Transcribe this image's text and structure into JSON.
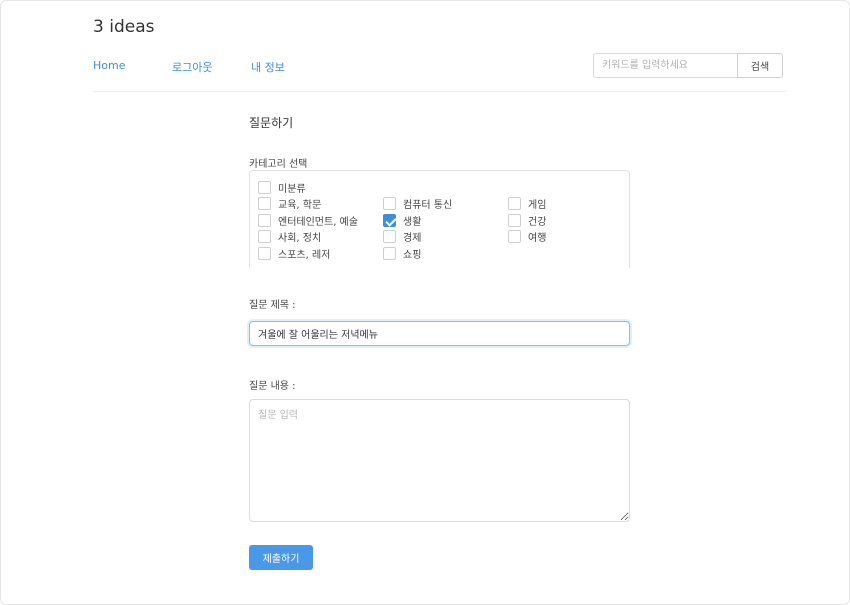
{
  "brand": "3 ideas",
  "nav": {
    "home": "Home",
    "logout": "로그아웃",
    "my_info": "내 정보"
  },
  "search": {
    "placeholder": "키워드를 입력하세요",
    "button": "검색"
  },
  "form": {
    "title": "질문하기",
    "category_label": "카테고리 선택",
    "categories": [
      {
        "label": "미분류",
        "checked": false
      },
      {
        "label": "교육, 학문",
        "checked": false
      },
      {
        "label": "엔터테인먼트, 예술",
        "checked": false
      },
      {
        "label": "사회, 정치",
        "checked": false
      },
      {
        "label": "스포츠, 레저",
        "checked": false
      },
      {
        "label": "컴퓨터 통신",
        "checked": false
      },
      {
        "label": "생활",
        "checked": true
      },
      {
        "label": "경제",
        "checked": false
      },
      {
        "label": "쇼핑",
        "checked": false
      },
      {
        "label": "게임",
        "checked": false
      },
      {
        "label": "건강",
        "checked": false
      },
      {
        "label": "여행",
        "checked": false
      }
    ],
    "question_title_label": "질문 제목 :",
    "question_title_value": "겨울에 잘 어울리는 저녁메뉴",
    "question_content_label": "질문 내용 :",
    "question_content_placeholder": "질문 입력",
    "submit": "제출하기"
  },
  "colors": {
    "accent": "#4a98e8",
    "link": "#3d8fd6"
  }
}
